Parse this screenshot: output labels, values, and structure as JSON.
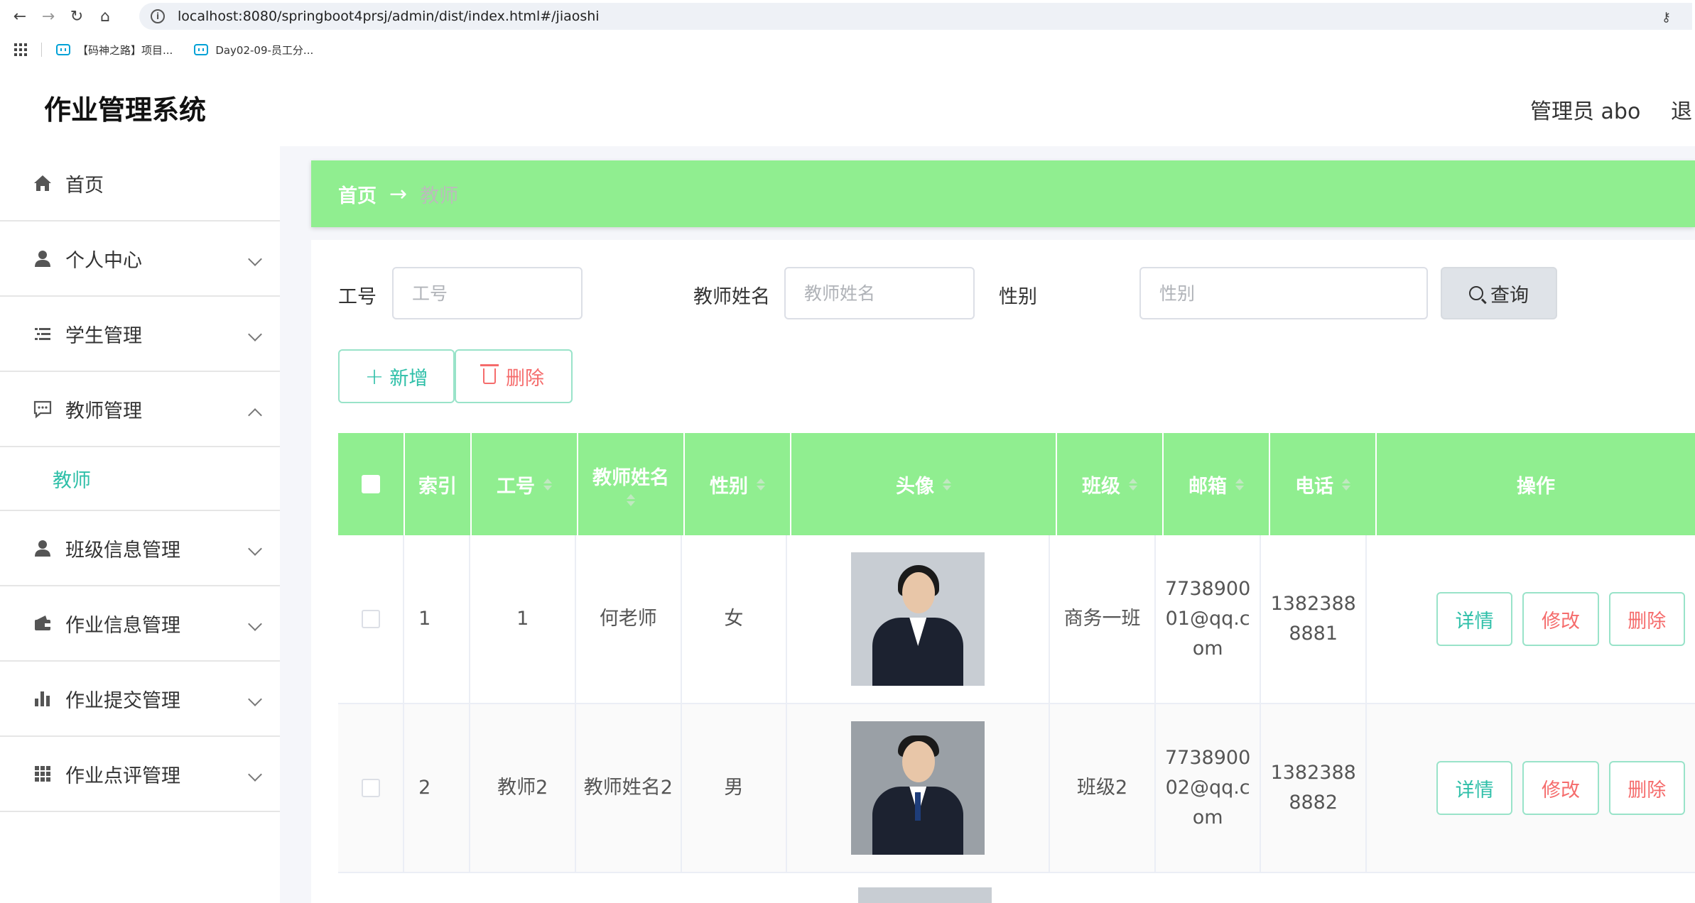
{
  "browser": {
    "url": "localhost:8080/springboot4prsj/admin/dist/index.html#/jiaoshi",
    "bookmarks": [
      "【码神之路】项目...",
      "Day02-09-员工分..."
    ]
  },
  "header": {
    "title": "作业管理系统",
    "user": "管理员 abo",
    "logout": "退"
  },
  "sidebar": {
    "items": [
      {
        "label": "首页",
        "icon": "home-icon"
      },
      {
        "label": "个人中心",
        "icon": "user-icon"
      },
      {
        "label": "学生管理",
        "icon": "list-icon"
      },
      {
        "label": "教师管理",
        "icon": "chat-icon",
        "expanded": true,
        "sub": "教师"
      },
      {
        "label": "班级信息管理",
        "icon": "user-icon"
      },
      {
        "label": "作业信息管理",
        "icon": "wallet-icon"
      },
      {
        "label": "作业提交管理",
        "icon": "bar-chart-icon"
      },
      {
        "label": "作业点评管理",
        "icon": "grid-icon"
      }
    ]
  },
  "breadcrumb": {
    "home": "首页",
    "arrow": "→",
    "current": "教师"
  },
  "search": {
    "gonghao_label": "工号",
    "gonghao_placeholder": "工号",
    "name_label": "教师姓名",
    "name_placeholder": "教师姓名",
    "gender_label": "性别",
    "gender_placeholder": "性别",
    "query_label": "查询"
  },
  "actions": {
    "add_label": "新增",
    "delete_label": "删除"
  },
  "table": {
    "headers": [
      "索引",
      "工号",
      "教师姓名",
      "性别",
      "头像",
      "班级",
      "邮箱",
      "电话",
      "操作"
    ],
    "rows": [
      {
        "index": "1",
        "gonghao": "1",
        "name": "何老师",
        "gender": "女",
        "class": "商务一班",
        "email": "773890001@qq.com",
        "phone": "13823888881"
      },
      {
        "index": "2",
        "gonghao": "教师2",
        "name": "教师姓名2",
        "gender": "男",
        "class": "班级2",
        "email": "773890002@qq.com",
        "phone": "13823888882"
      }
    ],
    "ops": {
      "detail": "详情",
      "edit": "修改",
      "delete": "删除"
    }
  },
  "colors": {
    "accent_green": "#90ee90",
    "teal_text": "#2ebfa8",
    "danger": "#f56c6c"
  }
}
